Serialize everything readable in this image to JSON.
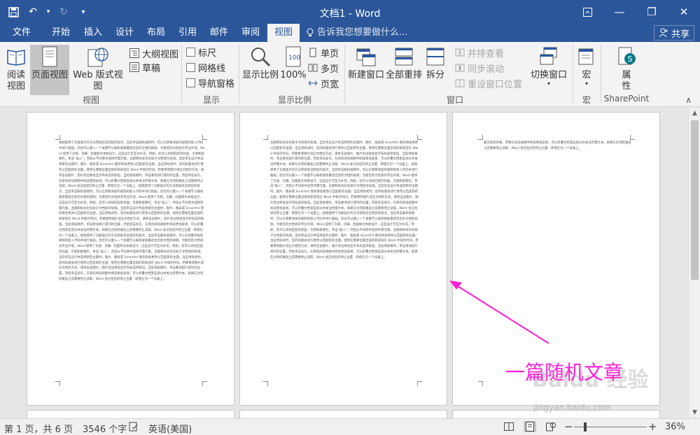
{
  "window": {
    "title": "文档1 - Word",
    "qat": {
      "save": "save-icon",
      "undo": "↶",
      "redo": "↻",
      "customize": "▾"
    },
    "controls": {
      "ribbon_options": "ribbon-display-icon",
      "minimize": "—",
      "restore": "❐",
      "close": "✕"
    }
  },
  "tabs": [
    "文件",
    "开始",
    "插入",
    "设计",
    "布局",
    "引用",
    "邮件",
    "审阅",
    "视图"
  ],
  "active_tab": "视图",
  "tell_me": "告诉我您想要做什么...",
  "share": "共享",
  "ribbon": {
    "views": {
      "group": "视图",
      "read_mode": "阅读\n视图",
      "print_layout": "页面视图",
      "web_layout": "Web 版式视图",
      "outline": "大纲视图",
      "draft": "草稿"
    },
    "show": {
      "group": "显示",
      "ruler": "标尺",
      "gridlines": "网格线",
      "nav_pane": "导航窗格"
    },
    "zoom": {
      "group": "显示比例",
      "zoom": "显示比例",
      "hundred": "100%",
      "one_page": "单页",
      "multi_page": "多页",
      "page_width": "页宽"
    },
    "window": {
      "group": "窗口",
      "new_window": "新建窗口",
      "arrange_all": "全部重排",
      "split": "拆分",
      "side_by_side": "并排查看",
      "sync_scroll": "同步滚动",
      "reset_pos": "重设窗口位置",
      "switch_windows": "切换窗口"
    },
    "macros": {
      "group": "宏",
      "macros": "宏"
    },
    "sharepoint": {
      "group": "SharePoint",
      "properties": "属\n性"
    }
  },
  "document": {
    "page1_text": "视频提供了功能强大的方法帮助您证明您的观点。当您单击联机视频时，可以在想要添加的视频的嵌入代码中进行粘贴。您也可以键入一个关键字以联机搜索最适合您的文档的视频。为使您的文档具有专业外观，Word 提供了页眉、页脚、封面和文本框设计，这些设计可互为补充。例如，您可以添加匹配的封面、页眉和提要栏。单击“插入”，然后从不同库中选择所需元素。主题和样式也有助于文档保持协调。当您单击设计并选择新的主题时，图片、图表或 SmartArt 图形将会更改以匹配新的主题。当应用样式时，您的标题会进行更改以匹配新的主题。使用在需要位置出现的新按钮在 Word 中保存时间。若要更改图片适应文档的方式，请单击该图片，图片旁边将会显示布局选项按钮。当处理表格时，单击要添加行或列的位置，然后单击加号。在新的阅读视图中阅读更加容易。可以折叠文档某些部分并关注所需文本。如果在达到结尾处之前需要停止读取，Word 会记住您的停止位置 - 即使在另一个设备上。视频提供了功能强大的方法帮助您证明您的观点。当您单击联机视频时，可以在想要添加的视频的嵌入代码中进行粘贴。您也可以键入一个关键字以联机搜索最适合您的文档的视频。为使您的文档具有专业外观，Word 提供了页眉、页脚、封面和文本框设计，这些设计可互为补充。例如，您可以添加匹配的封面、页眉和提要栏。单击“插入”，然后从不同库中选择所需元素。主题和样式也有助于文档保持协调。当您单击设计并选择新的主题时，图片、图表或 SmartArt 图形将会更改以匹配新的主题。当应用样式时，您的标题会进行更改以匹配新的主题。使用在需要位置出现的新按钮在 Word 中保存时间。若要更改图片适应文档的方式，请单击该图片，图片旁边将会显示布局选项按钮。当处理表格时，单击要添加行或列的位置，然后单击加号。在新的阅读视图中阅读更加容易。可以折叠文档某些部分并关注所需文本。如果在达到结尾处之前需要停止读取，Word 会记住您的停止位置 - 即使在另一个设备上。视频提供了功能强大的方法帮助您证明您的观点。当您单击联机视频时，可以在想要添加的视频的嵌入代码中进行粘贴。您也可以键入一个关键字以联机搜索最适合您的文档的视频。为使您的文档具有专业外观，Word 提供了页眉、页脚、封面和文本框设计，这些设计可互为补充。例如，您可以添加匹配的封面、页眉和提要栏。单击“插入”，然后从不同库中选择所需元素。主题和样式也有助于文档保持协调。当您单击设计并选择新的主题时，图片、图表或 SmartArt 图形将会更改以匹配新的主题。当应用样式时，您的标题会进行更改以匹配新的主题。使用在需要位置出现的新按钮在 Word 中保存时间。若要更改图片适应文档的方式，请单击该图片，图片旁边将会显示布局选项按钮。当处理表格时，单击要添加行或列的位置，然后单击加号。在新的阅读视图中阅读更加容易。可以折叠文档某些部分并关注所需文本。如果在达到结尾处之前需要停止读取，Word 会记住您的停止位置 - 即使在另一个设备上。",
    "page2_text": "主题和样式也有助于文档保持协调。当您单击设计并选择新的主题时，图片、图表或 SmartArt 图形将会更改以匹配新的主题。当应用样式时，您的标题会进行更改以匹配新的主题。使用在需要位置出现的新按钮在 Word 中保存时间。若要更改图片适应文档的方式，请单击该图片，图片旁边将会显示布局选项按钮。当处理表格时，单击要添加行或列的位置，然后单击加号。在新的阅读视图中阅读更加容易。可以折叠文档某些部分并关注所需文本。如果在达到结尾处之前需要停止读取，Word 会记住您的停止位置 - 即使在另一个设备上。视频提供了功能强大的方法帮助您证明您的观点。当您单击联机视频时，可以在想要添加的视频的嵌入代码中进行粘贴。您也可以键入一个关键字以联机搜索最适合您的文档的视频。为使您的文档具有专业外观，Word 提供了页眉、页脚、封面和文本框设计，这些设计可互为补充。例如，您可以添加匹配的封面、页眉和提要栏。单击“插入”，然后从不同库中选择所需元素。主题和样式也有助于文档保持协调。当您单击设计并选择新的主题时，图片、图表或 SmartArt 图形将会更改以匹配新的主题。当应用样式时，您的标题会进行更改以匹配新的主题。使用在需要位置出现的新按钮在 Word 中保存时间。若要更改图片适应文档的方式，请单击该图片，图片旁边将会显示布局选项按钮。当处理表格时，单击要添加行或列的位置，然后单击加号。在新的阅读视图中阅读更加容易。可以折叠文档某些部分并关注所需文本。如果在达到结尾处之前需要停止读取，Word 会记住您的停止位置 - 即使在另一个设备上。视频提供了功能强大的方法帮助您证明您的观点。当您单击联机视频时，可以在想要添加的视频的嵌入代码中进行粘贴。您也可以键入一个关键字以联机搜索最适合您的文档的视频。为使您的文档具有专业外观，Word 提供了页眉、页脚、封面和文本框设计，这些设计可互为补充。例如，您可以添加匹配的封面、页眉和提要栏。单击“插入”，然后从不同库中选择所需元素。主题和样式也有助于文档保持协调。当您单击设计并选择新的主题时，图片、图表或 SmartArt 图形将会更改以匹配新的主题。当应用样式时，您的标题会进行更改以匹配新的主题。使用在需要位置出现的新按钮在 Word 中保存时间。若要更改图片适应文档的方式，请单击该图片，图片旁边将会显示布局选项按钮。当处理表格时，单击要添加行或列的位置，然后单击加号。在新的阅读视图中阅读更加容易。可以折叠文档某些部分并关注所需文本。如果在达到结尾处之前需要停止读取，Word 会记住您的停止位置 - 即使在另一个设备上。",
    "page3_text": "最佳阅读效果。若要在阅读视图中阅读更加容易，可以折叠文档某些部分并关注所需文本。如果在达到结尾处之前需要停止读取，Word 会记住您的停止位置 - 即使在另一个设备上。",
    "annotation": "一篇随机文章",
    "watermark": "Baidu 经验",
    "watermark_url": "jingyan.baidu.com"
  },
  "status": {
    "page": "第 1 页，共 6 页",
    "words": "3546 个字",
    "language": "英语(美国)",
    "zoom_minus": "−",
    "zoom_plus": "+",
    "zoom_percent": "36%"
  },
  "colors": {
    "brand": "#2b579a",
    "annotation": "#ff1fd6"
  }
}
